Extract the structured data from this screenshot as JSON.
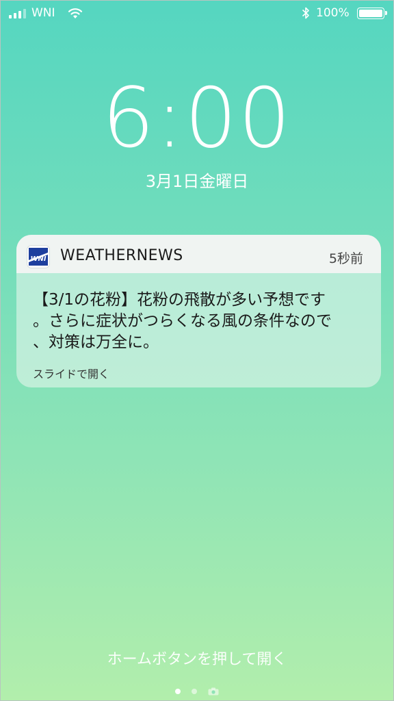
{
  "status_bar": {
    "carrier": "WNI",
    "battery_percent": "100%",
    "icons": [
      "signal-icon",
      "wifi-icon",
      "bluetooth-icon",
      "battery-icon"
    ]
  },
  "lock_screen": {
    "time": "6:00",
    "date": "3月1日金曜日",
    "home_hint": "ホームボタンを押して開く"
  },
  "notification": {
    "app_name": "WEATHERNEWS",
    "app_icon": "wni-logo-icon",
    "time_ago": "5秒前",
    "body_lines": [
      "【3/1の花粉】花粉の飛散が多い予想です",
      "。さらに症状がつらくなる風の条件なので",
      "、対策は万全に。"
    ],
    "action_hint": "スライドで開く"
  },
  "page_indicator": {
    "pages": 2,
    "active_index": 0,
    "camera_icon": "camera-icon"
  },
  "colors": {
    "background_top": "#55d6c0",
    "background_bottom": "#b2eeac",
    "wni_blue": "#1e3f9e"
  }
}
